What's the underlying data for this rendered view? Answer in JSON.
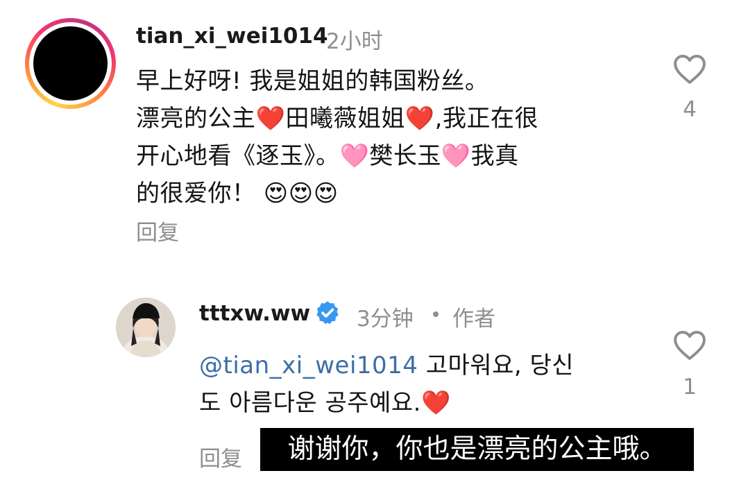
{
  "comment1": {
    "username": "tian_xi_wei1014",
    "time": "2小时",
    "text": "早上好呀! 我是姐姐的韩国粉丝。\n漂亮的公主❤️田曦薇姐姐❤️,我正在很\n开心地看《逐玉》。🩷樊长玉🩷我真\n的很爱你！ 😍😍😍",
    "reply_label": "回复",
    "like_count": "4",
    "avatar_icon": "avatar-story-ring"
  },
  "comment2": {
    "username": "tttxw.ww",
    "verified_icon": "verified-badge-icon",
    "time": "3分钟",
    "author_label": "作者",
    "mention": "@tian_xi_wei1014",
    "text_after_mention": " 고마워요, 당신\n도 아름다운 공주예요.❤️",
    "reply_label": "回复",
    "like_count": "1"
  },
  "subtitle": "谢谢你，你也是漂亮的公主哦。",
  "colors": {
    "mention": "#3b6ea5",
    "verified": "#3897f0",
    "secondary_text": "#8e8e8e"
  }
}
